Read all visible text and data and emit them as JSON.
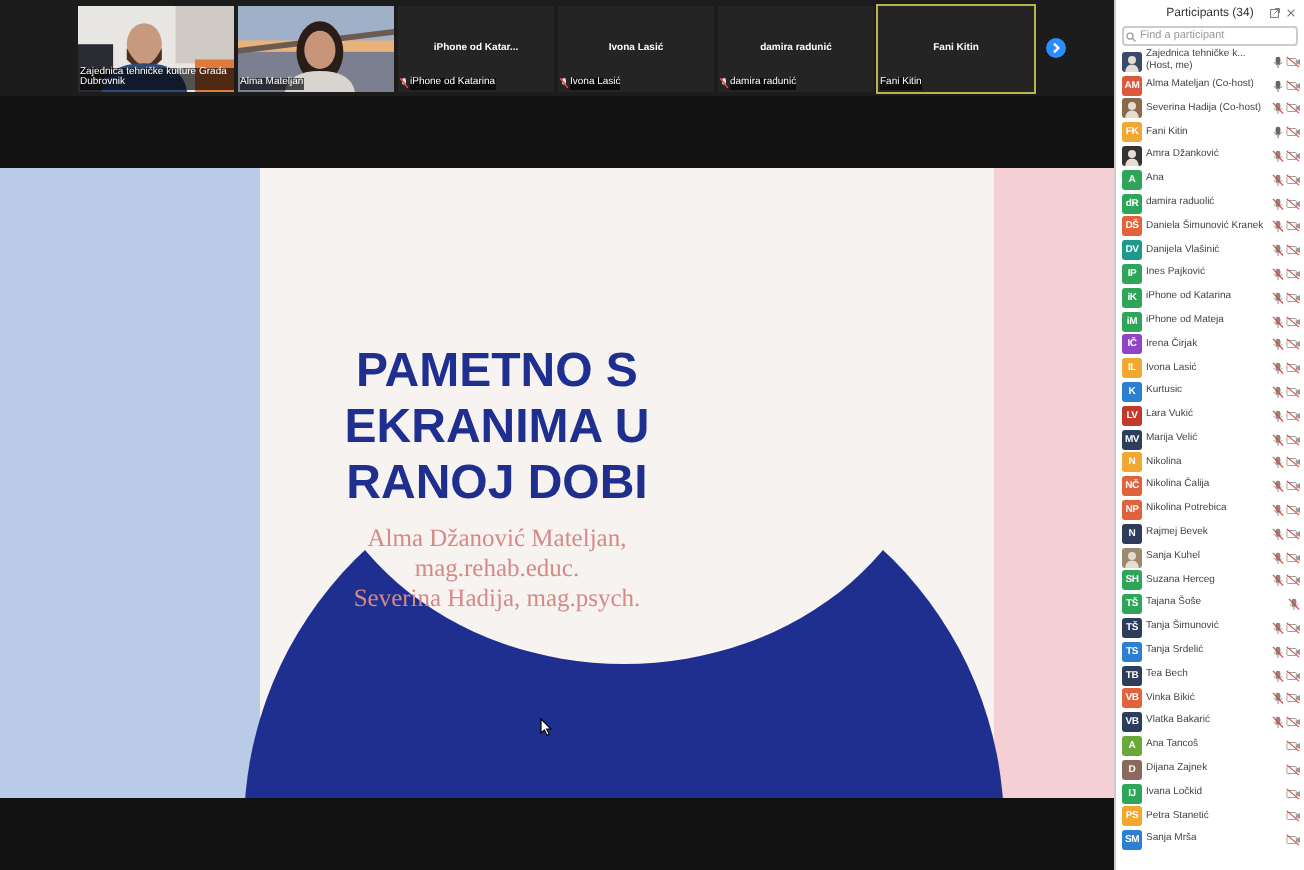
{
  "video_strip": {
    "tiles": [
      {
        "kind": "video",
        "name": "Zajednica tehničke kulture Grada Dubrovnik",
        "muted": false,
        "active": false
      },
      {
        "kind": "video",
        "name": "Alma Mateljan",
        "muted": false,
        "active": false
      },
      {
        "kind": "name",
        "title": "iPhone  od  Katar...",
        "name": "iPhone od Katarina",
        "muted": true,
        "active": false
      },
      {
        "kind": "name",
        "title": "Ivona Lasić",
        "name": "Ivona Lasić",
        "muted": true,
        "active": false
      },
      {
        "kind": "name",
        "title": "damira radunić",
        "name": "damira radunić",
        "muted": true,
        "active": false
      },
      {
        "kind": "name",
        "title": "Fani Kitin",
        "name": "Fani Kitin",
        "muted": false,
        "active": true
      }
    ]
  },
  "slide": {
    "title": "PAMETNO S EKRANIMA U RANOJ DOBI",
    "authors": [
      "Alma Džanović Mateljan,",
      "mag.rehab.educ.",
      "Severina Hadija, mag.psych."
    ]
  },
  "participants": {
    "title": "Participants (34)",
    "search": {
      "placeholder": "Find a participant"
    },
    "items": [
      {
        "name": "Zajednica tehničke k... (Host, me)",
        "kind": "picture",
        "color": "#3b4a6b",
        "audio": true,
        "muted": false,
        "video_off": true
      },
      {
        "name": "Alma Mateljan (Co-host)",
        "kind": "initials",
        "avatar": "AM",
        "color": "#d9593d",
        "audio": true,
        "muted": false,
        "video_off": true
      },
      {
        "name": "Severina Hadija (Co-host)",
        "kind": "picture",
        "color": "#8a6a4a",
        "audio": true,
        "muted": true,
        "video_off": true
      },
      {
        "name": "Fani Kitin",
        "kind": "initials",
        "avatar": "FK",
        "color": "#f0a830",
        "audio": true,
        "muted": false,
        "video_off": true
      },
      {
        "name": "Amra Džanković",
        "kind": "picture",
        "color": "#333333",
        "audio": true,
        "muted": true,
        "video_off": true
      },
      {
        "name": "Ana",
        "kind": "initials",
        "avatar": "A",
        "color": "#2fa55a",
        "audio": true,
        "muted": true,
        "video_off": true
      },
      {
        "name": "damira raduolić",
        "kind": "initials",
        "avatar": "dR",
        "color": "#2fa55a",
        "audio": true,
        "muted": true,
        "video_off": true
      },
      {
        "name": "Daniela Šimunović Kranek",
        "kind": "initials",
        "avatar": "DŠ",
        "color": "#e0633c",
        "audio": true,
        "muted": true,
        "video_off": true
      },
      {
        "name": "Danijela Vlašinić",
        "kind": "initials",
        "avatar": "DV",
        "color": "#1f9a8a",
        "audio": true,
        "muted": true,
        "video_off": true
      },
      {
        "name": "Ines Pajković",
        "kind": "initials",
        "avatar": "IP",
        "color": "#2fa55a",
        "audio": true,
        "muted": true,
        "video_off": true
      },
      {
        "name": "iPhone od Katarina",
        "kind": "initials",
        "avatar": "iK",
        "color": "#2fa55a",
        "audio": true,
        "muted": true,
        "video_off": true
      },
      {
        "name": "iPhone od Mateja",
        "kind": "initials",
        "avatar": "iM",
        "color": "#2fa55a",
        "audio": true,
        "muted": true,
        "video_off": true
      },
      {
        "name": "Irena Čirjak",
        "kind": "initials",
        "avatar": "IČ",
        "color": "#8e44c4",
        "audio": true,
        "muted": true,
        "video_off": true
      },
      {
        "name": "Ivona Lasić",
        "kind": "initials",
        "avatar": "IL",
        "color": "#f0a830",
        "audio": true,
        "muted": true,
        "video_off": true
      },
      {
        "name": "Kurtusic",
        "kind": "initials",
        "avatar": "K",
        "color": "#2d7fd0",
        "audio": true,
        "muted": true,
        "video_off": true
      },
      {
        "name": "Lara Vukić",
        "kind": "initials",
        "avatar": "LV",
        "color": "#c0392b",
        "audio": true,
        "muted": true,
        "video_off": true
      },
      {
        "name": "Marija Velić",
        "kind": "initials",
        "avatar": "MV",
        "color": "#2c3e5a",
        "audio": true,
        "muted": true,
        "video_off": true
      },
      {
        "name": "Nikolina",
        "kind": "initials",
        "avatar": "N",
        "color": "#f0a830",
        "audio": true,
        "muted": true,
        "video_off": true
      },
      {
        "name": "Nikolina Čalija",
        "kind": "initials",
        "avatar": "NČ",
        "color": "#e0633c",
        "audio": true,
        "muted": true,
        "video_off": true
      },
      {
        "name": "Nikolina Potrebica",
        "kind": "initials",
        "avatar": "NP",
        "color": "#e0633c",
        "audio": true,
        "muted": true,
        "video_off": true
      },
      {
        "name": "Rajmej Bevek",
        "kind": "initials",
        "avatar": "N",
        "color": "#2c3e5a",
        "audio": true,
        "muted": true,
        "video_off": true
      },
      {
        "name": "Sanja Kuhel",
        "kind": "picture",
        "color": "#9a8a70",
        "audio": true,
        "muted": true,
        "video_off": true
      },
      {
        "name": "Suzana Herceg",
        "kind": "initials",
        "avatar": "SH",
        "color": "#2fa55a",
        "audio": true,
        "muted": true,
        "video_off": true
      },
      {
        "name": "Tajana Šoše",
        "kind": "initials",
        "avatar": "TŠ",
        "color": "#2fa55a",
        "audio": true,
        "muted": true,
        "video_off": false
      },
      {
        "name": "Tanja Šimunović",
        "kind": "initials",
        "avatar": "TŠ",
        "color": "#2c3e5a",
        "audio": true,
        "muted": true,
        "video_off": true
      },
      {
        "name": "Tanja Srdelić",
        "kind": "initials",
        "avatar": "TS",
        "color": "#2d7fd0",
        "audio": true,
        "muted": true,
        "video_off": true
      },
      {
        "name": "Tea Bech",
        "kind": "initials",
        "avatar": "TB",
        "color": "#2c3e5a",
        "audio": true,
        "muted": true,
        "video_off": true
      },
      {
        "name": "Vinka Bikić",
        "kind": "initials",
        "avatar": "VB",
        "color": "#e0633c",
        "audio": true,
        "muted": true,
        "video_off": true
      },
      {
        "name": "Vlatka Bakarić",
        "kind": "initials",
        "avatar": "VB",
        "color": "#2c3e5a",
        "audio": true,
        "muted": true,
        "video_off": true
      },
      {
        "name": "Ana Tancoš",
        "kind": "initials",
        "avatar": "A",
        "color": "#6aa83a",
        "audio": false,
        "video_off": true
      },
      {
        "name": "Dijana Zajnek",
        "kind": "initials",
        "avatar": "D",
        "color": "#8a6a5a",
        "audio": false,
        "video_off": true
      },
      {
        "name": "Ivana Ločkid",
        "kind": "initials",
        "avatar": "IJ",
        "color": "#2fa55a",
        "audio": false,
        "video_off": true
      },
      {
        "name": "Petra Stanetić",
        "kind": "initials",
        "avatar": "PS",
        "color": "#f0a830",
        "audio": false,
        "video_off": true
      },
      {
        "name": "Sanja Mrša",
        "kind": "initials",
        "avatar": "SM",
        "color": "#2d7fd0",
        "audio": false,
        "video_off": true
      }
    ]
  }
}
